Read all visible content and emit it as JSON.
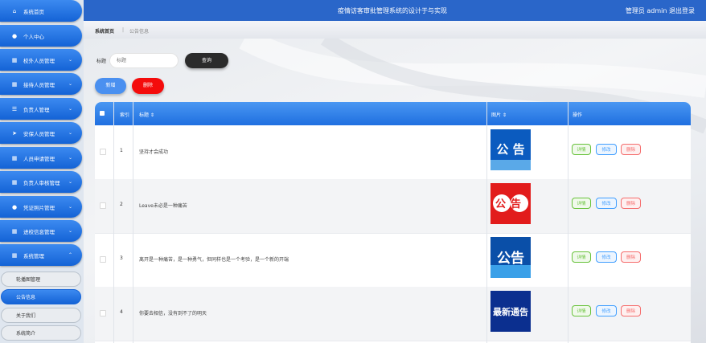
{
  "header": {
    "title": "疫情访客审批管理系统的设计于与实现",
    "user": "管理员 admin  退出登录"
  },
  "breadcrumb": {
    "home": "系统首页",
    "separator": "|",
    "current": "公告信息"
  },
  "sidebar": {
    "items": [
      {
        "label": "系统首页",
        "icon": "home-icon"
      },
      {
        "label": "个人中心",
        "icon": "user-icon"
      },
      {
        "label": "校外人员管理",
        "icon": "grid-icon"
      },
      {
        "label": "接待人员管理",
        "icon": "grid-icon"
      },
      {
        "label": "负责人管理",
        "icon": "list-icon"
      },
      {
        "label": "安保人员管理",
        "icon": "send-icon"
      },
      {
        "label": "人员申请管理",
        "icon": "grid-icon"
      },
      {
        "label": "负责人审核管理",
        "icon": "grid-icon"
      },
      {
        "label": "凭证照片管理",
        "icon": "user-icon"
      },
      {
        "label": "进校信息管理",
        "icon": "grid-icon"
      },
      {
        "label": "系统管理",
        "icon": "grid-icon"
      }
    ],
    "subitems": [
      {
        "label": "轮播图管理"
      },
      {
        "label": "公告信息"
      },
      {
        "label": "关于我们"
      },
      {
        "label": "系统简介"
      }
    ]
  },
  "search": {
    "label": "标题",
    "placeholder": "标题",
    "button": "查询"
  },
  "actions": {
    "add": "新增",
    "delete": "删除"
  },
  "table": {
    "headers": {
      "index": "索引",
      "title": "标题 ⇕",
      "image": "图片 ⇕",
      "ops": "操作"
    },
    "rows": [
      {
        "index": "1",
        "title": "坚持才会成功",
        "image_text": "公  告"
      },
      {
        "index": "2",
        "title": "Leave未必是一种痛苦",
        "image_text": "公告"
      },
      {
        "index": "3",
        "title": "离开是一种痛苦，是一种勇气，但同样也是一个考验，是一个新的开端",
        "image_text": "公告"
      },
      {
        "index": "4",
        "title": "你要去相信，没有到不了的明天",
        "image_text": "最新通告"
      }
    ],
    "op_labels": {
      "detail": "详情",
      "edit": "修改",
      "remove": "删除"
    }
  },
  "colors": {
    "primary": "#1f6fe0",
    "danger": "#f40c0c",
    "header": "#2a66c9"
  }
}
